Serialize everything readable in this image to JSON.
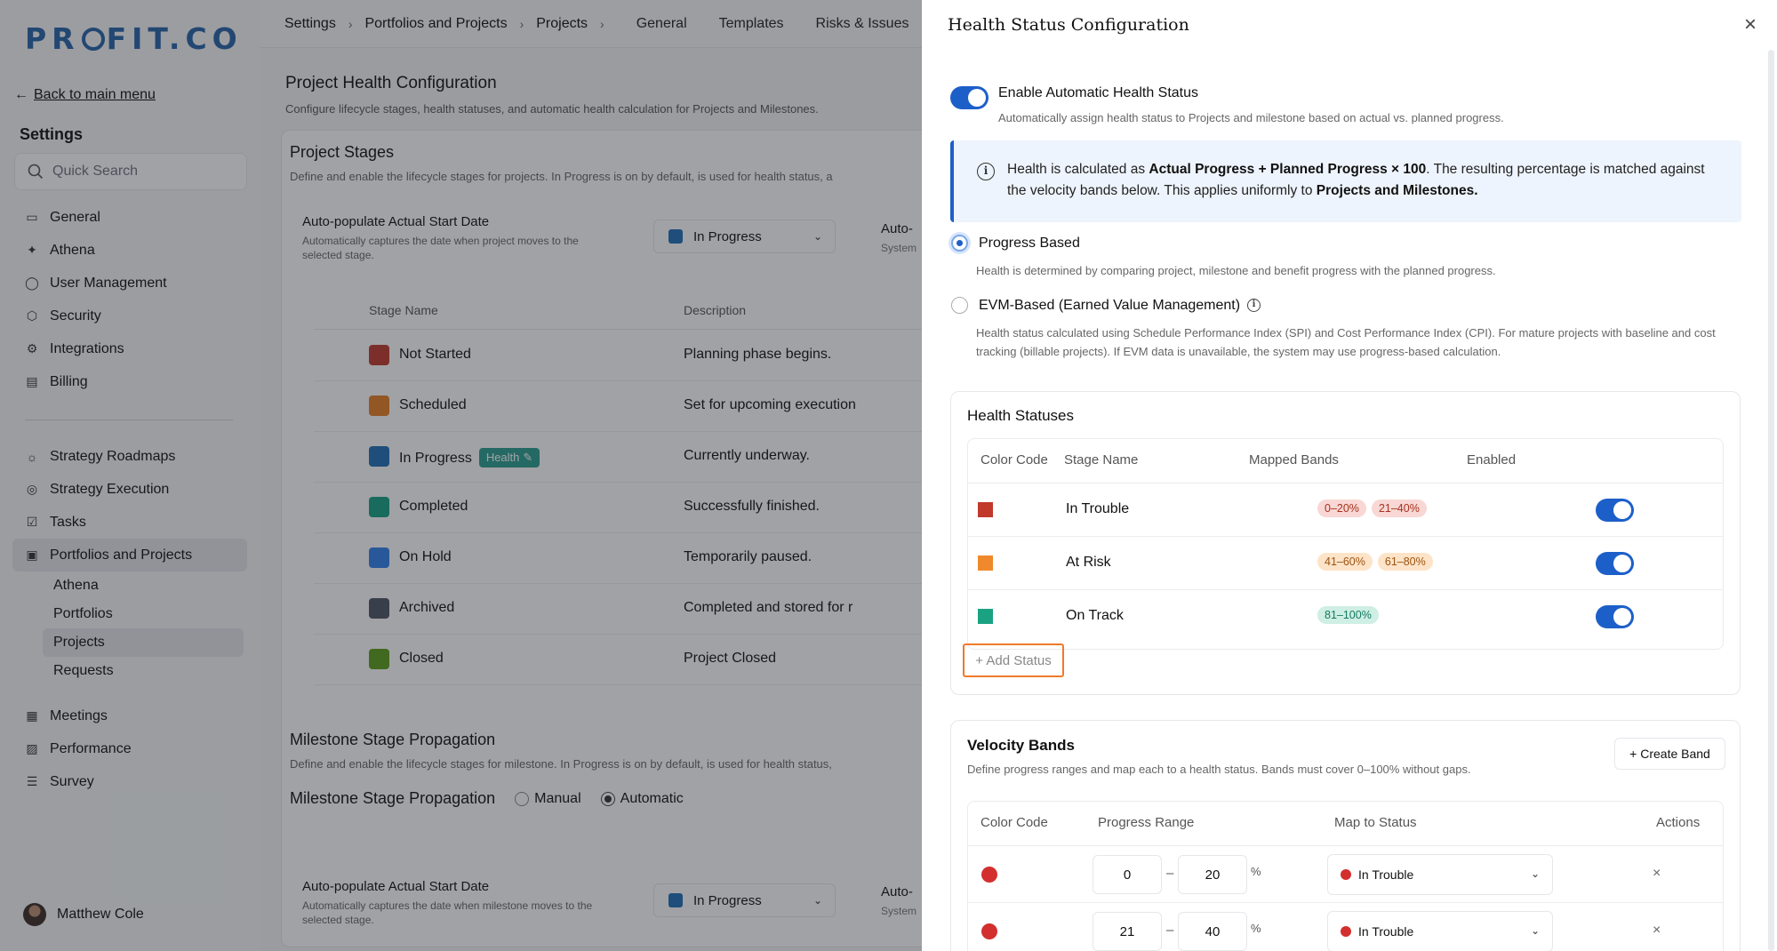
{
  "app": {
    "logo": "PROFIT.CO",
    "back_label": "Back to main menu",
    "settings_title": "Settings",
    "search_placeholder": "Quick Search"
  },
  "sidebar": {
    "items": [
      {
        "label": "General",
        "icon": "monitor-icon"
      },
      {
        "label": "Athena",
        "icon": "sparkle-icon"
      },
      {
        "label": "User Management",
        "icon": "user-icon"
      },
      {
        "label": "Security",
        "icon": "shield-icon"
      },
      {
        "label": "Integrations",
        "icon": "gear-icon"
      },
      {
        "label": "Billing",
        "icon": "receipt-icon"
      }
    ],
    "items2": [
      {
        "label": "Strategy Roadmaps",
        "icon": "sun-icon"
      },
      {
        "label": "Strategy Execution",
        "icon": "target-icon"
      },
      {
        "label": "Tasks",
        "icon": "checkbox-icon"
      },
      {
        "label": "Portfolios and Projects",
        "icon": "briefcase-icon"
      }
    ],
    "sub_items": [
      "Athena",
      "Portfolios",
      "Projects",
      "Requests"
    ],
    "items3": [
      {
        "label": "Meetings",
        "icon": "calendar-icon"
      },
      {
        "label": "Performance",
        "icon": "chart-icon"
      },
      {
        "label": "Survey",
        "icon": "list-icon"
      }
    ],
    "user_name": "Matthew Cole"
  },
  "topnav": {
    "crumbs": [
      "Settings",
      "Portfolios and Projects",
      "Projects"
    ],
    "tabs": [
      "General",
      "Templates",
      "Risks & Issues"
    ]
  },
  "page": {
    "title": "Project Health Configuration",
    "desc": "Configure lifecycle stages, health statuses, and automatic health calculation for Projects and Milestones.",
    "stages_title": "Project Stages",
    "stages_desc": "Define and enable the lifecycle stages for projects. In Progress is on by default, is used for health status, a",
    "auto_title": "Auto-populate Actual Start Date",
    "auto_desc": "Automatically captures the date when project moves to the selected stage.",
    "auto_value": "In Progress",
    "auto_cut_title": "Auto-",
    "auto_cut_desc": "System",
    "col_stage": "Stage Name",
    "col_desc": "Description",
    "health_badge": "Health",
    "stages": [
      {
        "name": "Not Started",
        "desc": "Planning phase begins.",
        "color": "#c0392b"
      },
      {
        "name": "Scheduled",
        "desc": "Set for upcoming execution",
        "color": "#e67e22"
      },
      {
        "name": "In Progress",
        "desc": "Currently underway.",
        "color": "#1f6fb7"
      },
      {
        "name": "Completed",
        "desc": "Successfully finished.",
        "color": "#16a085"
      },
      {
        "name": "On Hold",
        "desc": "Temporarily paused.",
        "color": "#2f80ed"
      },
      {
        "name": "Archived",
        "desc": "Completed and stored for r",
        "color": "#4b5563"
      },
      {
        "name": "Closed",
        "desc": "Project Closed",
        "color": "#5a9e1a"
      }
    ],
    "msp_title": "Milestone Stage Propagation",
    "msp_desc": "Define and enable the lifecycle stages for milestone. In Progress is on by default, is used for health status,",
    "msp_label": "Milestone Stage Propagation",
    "msp_manual": "Manual",
    "msp_automatic": "Automatic",
    "auto2_title": "Auto-populate Actual Start Date",
    "auto2_desc": "Automatically captures the date when milestone moves to the selected stage.",
    "auto2_value": "In Progress"
  },
  "drawer": {
    "title": "Health Status Configuration",
    "enable_title": "Enable Automatic Health Status",
    "enable_desc": "Automatically assign health status to Projects and milestone based on actual vs. planned progress.",
    "info_pre": "Health is calculated as ",
    "info_formula": "Actual Progress + Planned Progress × 100",
    "info_mid": ". The resulting percentage is matched against the velocity bands below. This applies uniformly to ",
    "info_target": "Projects and Milestones.",
    "opt1_label": "Progress Based",
    "opt1_desc": "Health is determined by comparing project, milestone and benefit progress with the planned progress.",
    "opt2_label": "EVM-Based (Earned Value Management)",
    "opt2_desc": "Health status calculated using Schedule Performance Index (SPI) and Cost Performance Index (CPI). For mature projects with baseline and cost tracking (billable projects). If EVM data is unavailable, the system may use progress-based calculation.",
    "hs_title": "Health Statuses",
    "hs_cols": [
      "Color Code",
      "Stage Name",
      "Mapped Bands",
      "Enabled"
    ],
    "statuses": [
      {
        "name": "In Trouble",
        "color": "#c0392b",
        "bands": [
          "0–20%",
          "21–40%"
        ],
        "band_bg": "#f8d7d4",
        "band_fg": "#a5321f"
      },
      {
        "name": "At Risk",
        "color": "#f0892b",
        "bands": [
          "41–60%",
          "61–80%"
        ],
        "band_bg": "#fde3c7",
        "band_fg": "#9c5413"
      },
      {
        "name": "On Track",
        "color": "#1aa283",
        "bands": [
          "81–100%"
        ],
        "band_bg": "#cfeee4",
        "band_fg": "#137a5f"
      }
    ],
    "add_status": "+ Add Status",
    "vb_title": "Velocity Bands",
    "vb_desc": "Define progress ranges and map each to a health status. Bands must cover 0–100% without gaps.",
    "create_band": "+ Create Band",
    "vb_cols": [
      "Color Code",
      "Progress Range",
      "Map to Status",
      "Actions"
    ],
    "bands": [
      {
        "from": "0",
        "to": "20",
        "status": "In Trouble",
        "color": "#d32f2f"
      },
      {
        "from": "21",
        "to": "40",
        "status": "In Trouble",
        "color": "#d32f2f"
      }
    ],
    "range_sep": "–",
    "pct": "%",
    "delete_glyph": "×"
  }
}
